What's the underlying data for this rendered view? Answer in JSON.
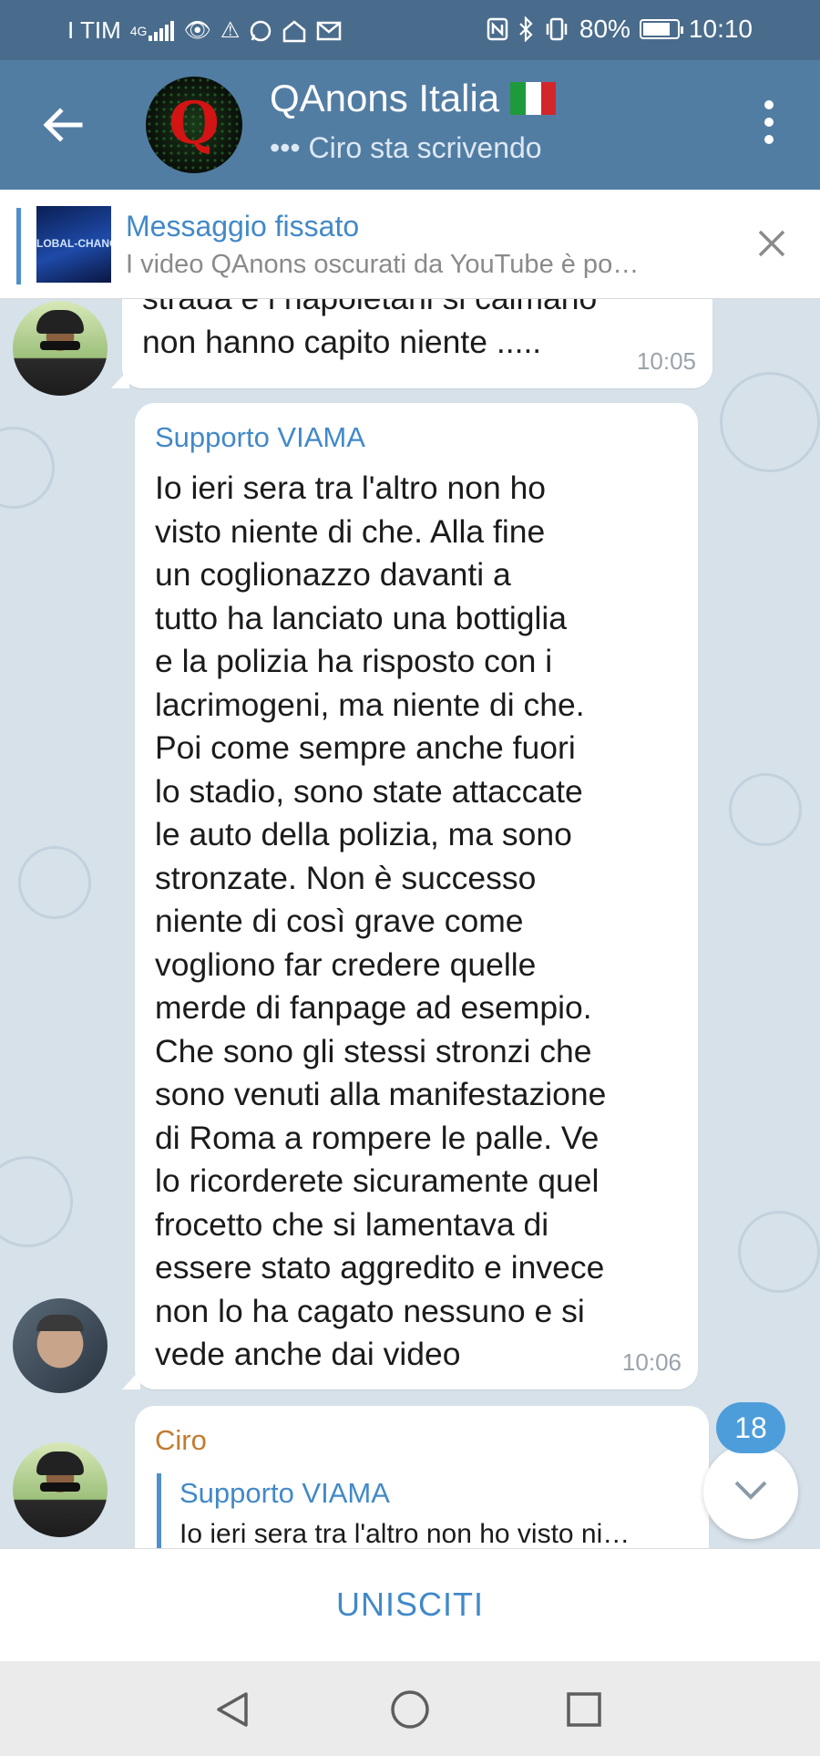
{
  "status_bar": {
    "carrier": "I TIM",
    "network": "4G",
    "battery_percent": "80%",
    "battery_level": 0.8,
    "time": "10:10",
    "icons": [
      "signal-icon",
      "eye-icon",
      "warning-icon",
      "whatsapp-icon",
      "home-icon",
      "mail-icon",
      "nfc-icon",
      "bluetooth-icon",
      "vibrate-icon",
      "battery-icon"
    ]
  },
  "header": {
    "title": "QAnons Italia",
    "title_emoji": "italian-flag-icon",
    "subtitle": "••• Ciro sta scrivendo",
    "avatar_letter": "Q",
    "colors": {
      "bar": "#527da3",
      "status": "#4a6c8c"
    }
  },
  "pinned": {
    "title": "Messaggio fissato",
    "text": "I video QAnons oscurati da YouTube è po…",
    "thumb_text": "LOBAL-CHANG"
  },
  "messages": [
    {
      "sender": "",
      "text": "strada e i napoletani si calmano\nnon hanno capito niente .....",
      "time": "10:05"
    },
    {
      "sender": "Supporto VIAMA",
      "sender_color": "#4289c8",
      "text": "Io ieri sera tra l'altro non ho\nvisto niente di che. Alla fine\nun coglionazzo davanti a\ntutto ha lanciato una bottiglia\ne la polizia ha risposto con i\nlacrimogeni, ma niente di che.\nPoi come sempre anche fuori\nlo stadio, sono state attaccate\nle auto della polizia, ma sono\nstronzate. Non è successo\nniente di così grave come\nvogliono far credere quelle\nmerde di fanpage ad esempio.\nChe sono gli stessi stronzi che\nsono venuti alla manifestazione\ndi Roma a rompere le palle. Ve\nlo ricorderete sicuramente quel\nfrocetto che si lamentava di\nessere stato aggredito e invece\nnon lo ha cagato nessuno e si\nvede anche dai video",
      "time": "10:06"
    },
    {
      "sender": "Ciro",
      "sender_color": "#c47a2e",
      "reply_to": {
        "sender": "Supporto VIAMA",
        "text": "Io ieri sera tra l'altro non ho visto ni…"
      }
    }
  ],
  "unread_badge": "18",
  "join_label": "UNISCITI"
}
